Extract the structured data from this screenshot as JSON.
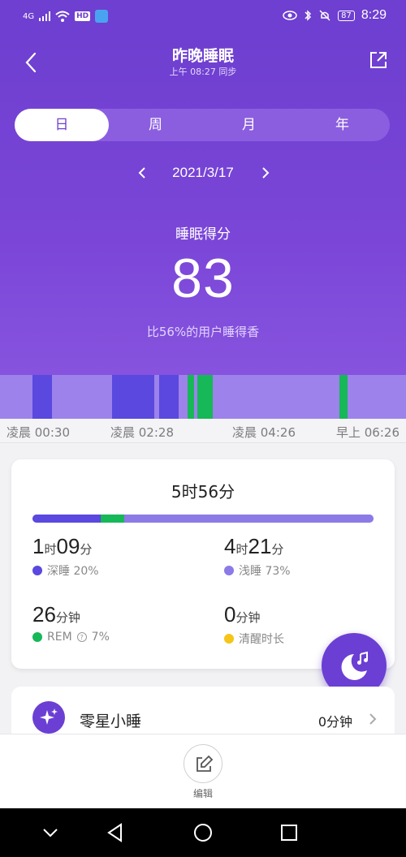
{
  "status_bar": {
    "signal": "4G",
    "hd": "HD",
    "battery": "87",
    "time": "8:29"
  },
  "header": {
    "title": "昨晚睡眠",
    "subtitle": "上午 08:27 同步"
  },
  "tabs": [
    "日",
    "周",
    "月",
    "年"
  ],
  "date": "2021/3/17",
  "score": {
    "label": "睡眠得分",
    "value": "83",
    "compare": "比56%的用户睡得香"
  },
  "time_axis": [
    "凌晨 00:30",
    "凌晨 02:28",
    "凌晨 04:26",
    "早上 06:26"
  ],
  "summary": {
    "total": "5时56分",
    "distribution": [
      {
        "key": "deep",
        "fraction": 0.2,
        "color": "#5a48df"
      },
      {
        "key": "rem",
        "fraction": 0.07,
        "color": "#16b857"
      },
      {
        "key": "light",
        "fraction": 0.73,
        "color": "#8c7ae6"
      }
    ],
    "deep": {
      "h": "1",
      "h_unit": "时",
      "m": "09",
      "m_unit": "分",
      "label": "深睡 20%",
      "color": "#5a48df"
    },
    "light": {
      "h": "4",
      "h_unit": "时",
      "m": "21",
      "m_unit": "分",
      "label": "浅睡 73%",
      "color": "#8c7ae6"
    },
    "rem": {
      "v": "26",
      "unit": "分钟",
      "label": "REM",
      "pct": "7%",
      "color": "#16b857"
    },
    "awake": {
      "v": "0",
      "unit": "分钟",
      "label": "清醒时长",
      "color": "#f5c518"
    }
  },
  "nap": {
    "label": "零星小睡",
    "value": "0分钟"
  },
  "edit": {
    "label": "编辑"
  },
  "colors": {
    "primary": "#6e3fd0",
    "deep": "#5a48df",
    "light": "#9c82ea",
    "rem": "#16b857",
    "awake": "#f5c518"
  }
}
